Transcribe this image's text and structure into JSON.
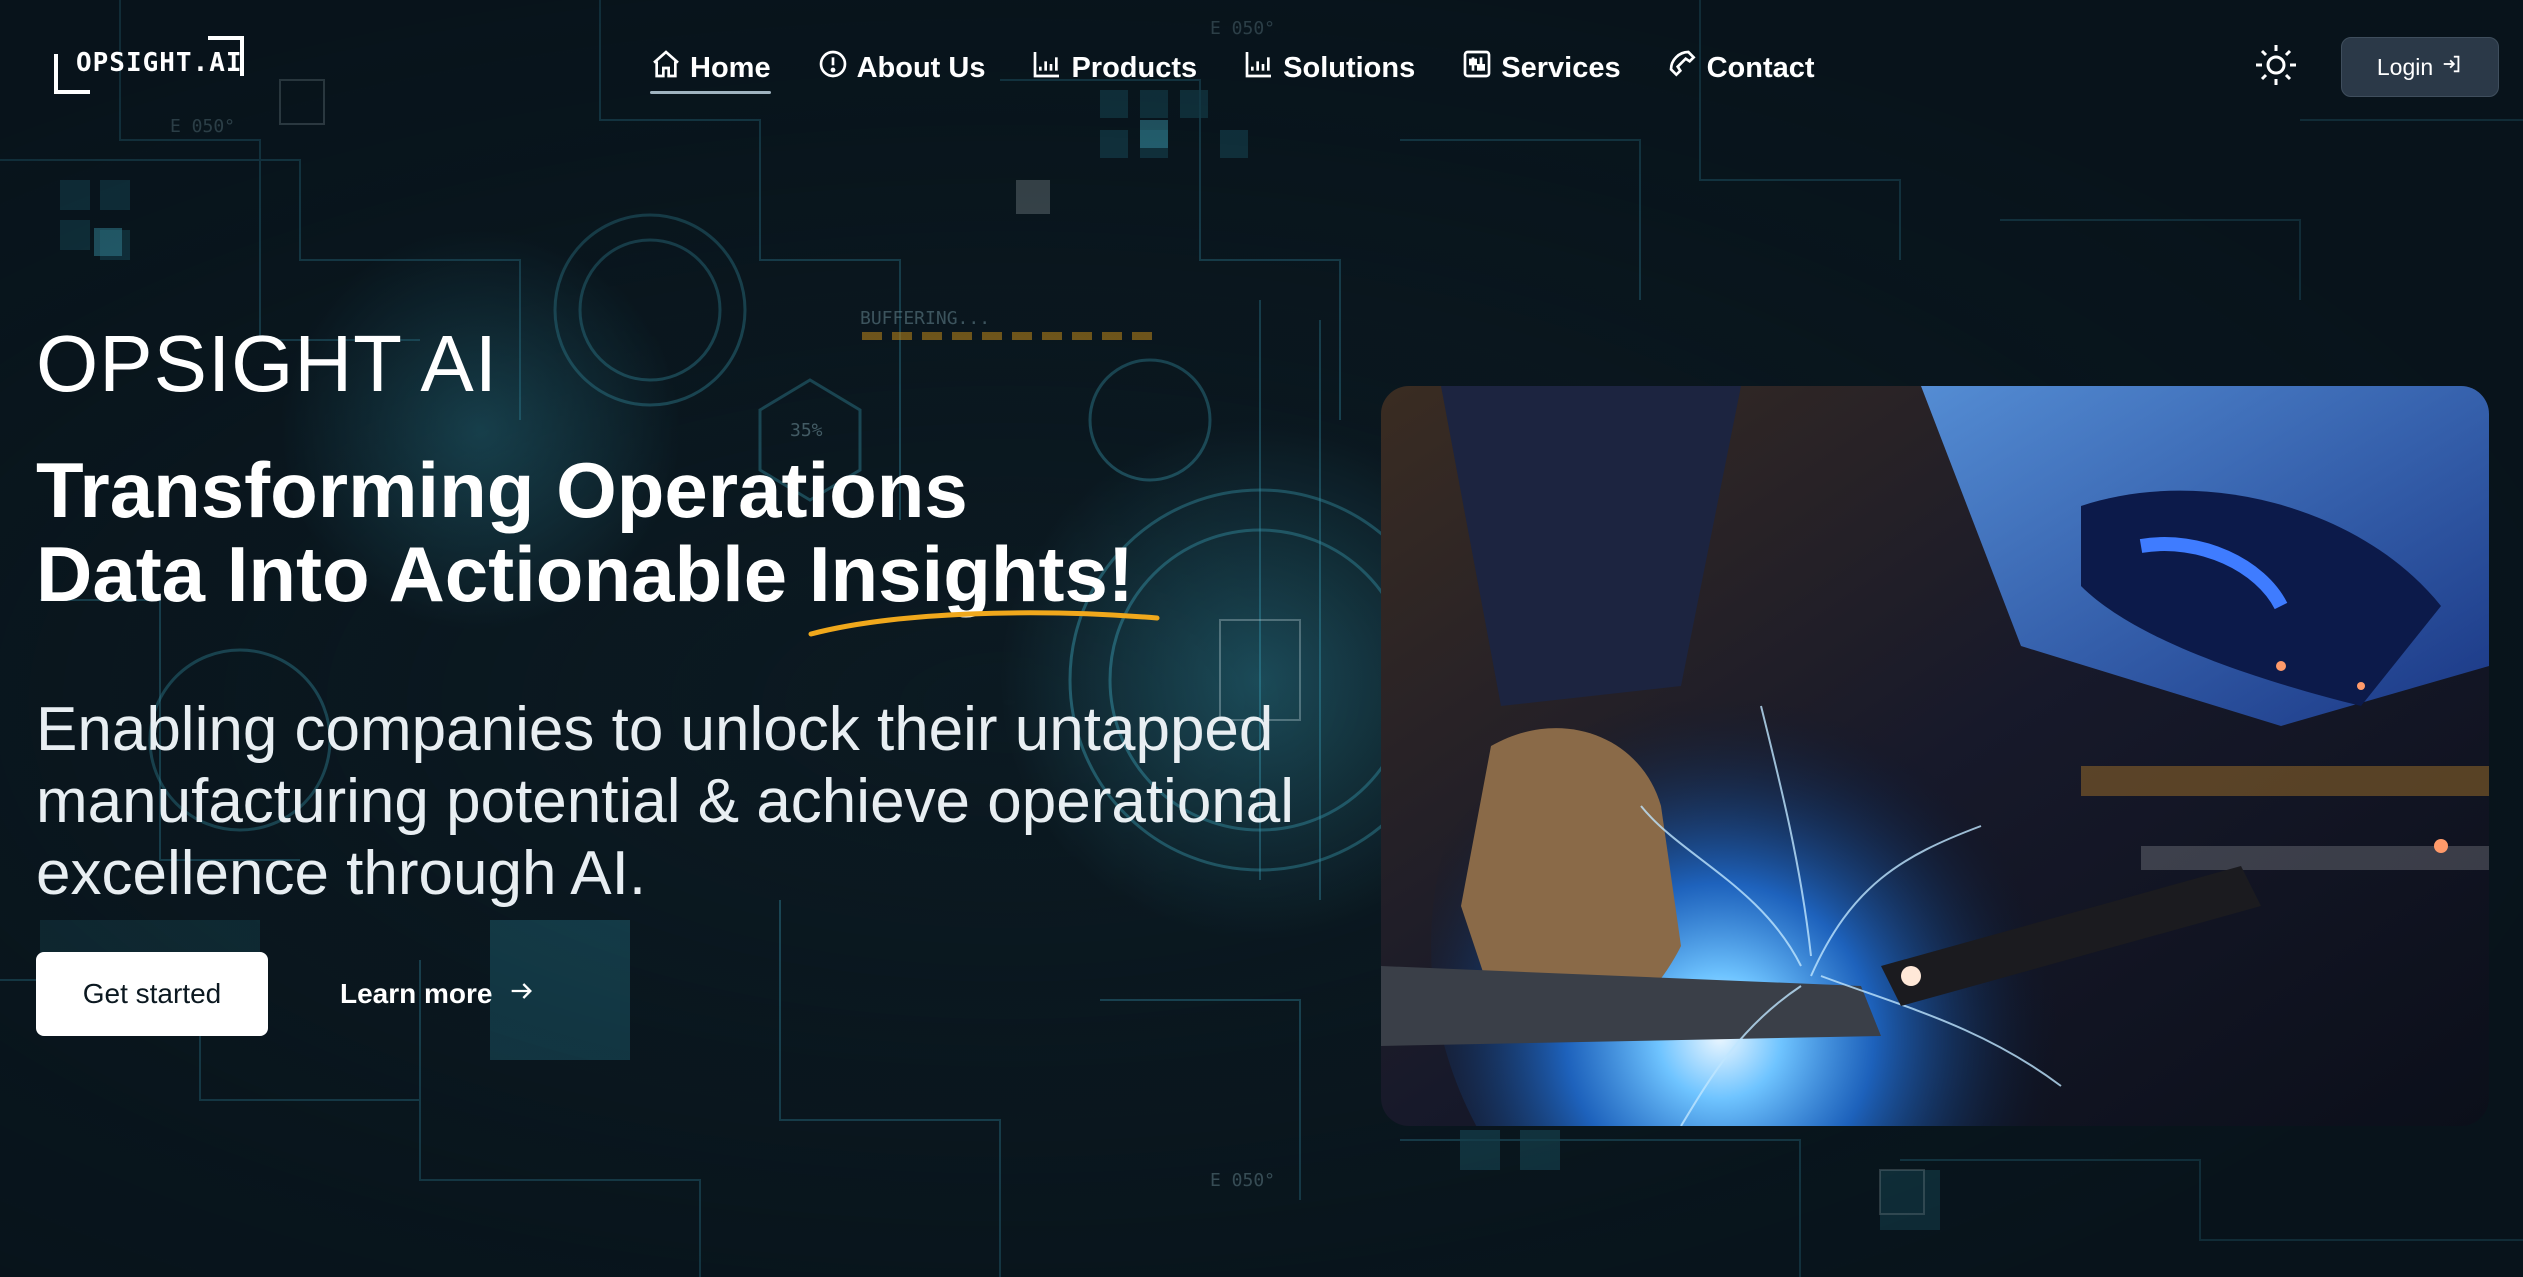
{
  "header": {
    "logo_text": "OPSIGHT.AI",
    "nav": [
      {
        "label": "Home",
        "icon": "home-icon",
        "active": true
      },
      {
        "label": "About Us",
        "icon": "info-circle-icon"
      },
      {
        "label": "Products",
        "icon": "chart-icon"
      },
      {
        "label": "Solutions",
        "icon": "chart-icon"
      },
      {
        "label": "Services",
        "icon": "sliders-icon"
      },
      {
        "label": "Contact",
        "icon": "phone-icon"
      }
    ],
    "theme_toggle_icon": "sun-icon",
    "login_label": "Login",
    "login_icon": "sign-in-icon"
  },
  "hero": {
    "brand_title": "OPSIGHT AI",
    "headline_line1": "Transforming Operations",
    "headline_line2_prefix": "Data Into Actionable ",
    "headline_highlight": "Insights!",
    "subtitle": "Enabling companies to unlock their untapped manufacturing potential & achieve operational excellence through AI.",
    "primary_cta": "Get started",
    "secondary_cta": "Learn more",
    "secondary_cta_icon": "arrow-right-icon",
    "image_subject": "welding-photo"
  },
  "colors": {
    "background": "#0b1820",
    "accent_underline": "#f0a81c",
    "circuit": "#2f7f95",
    "login_bg": "#2b3948"
  }
}
